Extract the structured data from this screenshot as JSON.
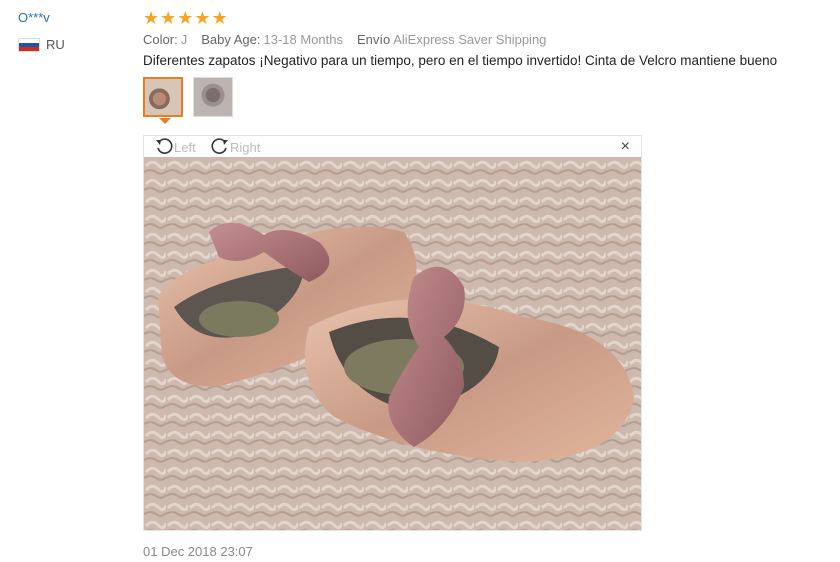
{
  "user": {
    "name": "O***v",
    "country": "RU",
    "flag_colors": [
      "#ffffff",
      "#1c57a7",
      "#d52b1e"
    ]
  },
  "review": {
    "rating": 5,
    "stars": [
      "★",
      "★",
      "★",
      "★",
      "★"
    ],
    "star_color": "#f5a623",
    "meta": [
      {
        "label": "Color:",
        "value": "J"
      },
      {
        "label": "Baby Age:",
        "value": "13-18 Months"
      },
      {
        "label": "Envío",
        "value": "AliExpress Saver Shipping"
      }
    ],
    "text": "Diferentes zapatos ¡Negativo para un tiempo, pero en el tiempo invertido! Cinta de Velcro mantiene bueno",
    "date": "01 Dec 2018 23:07"
  },
  "viewer": {
    "rotate_left_label": "Left",
    "rotate_right_label": "Right",
    "close_symbol": "×",
    "accent": "#e67e22"
  }
}
